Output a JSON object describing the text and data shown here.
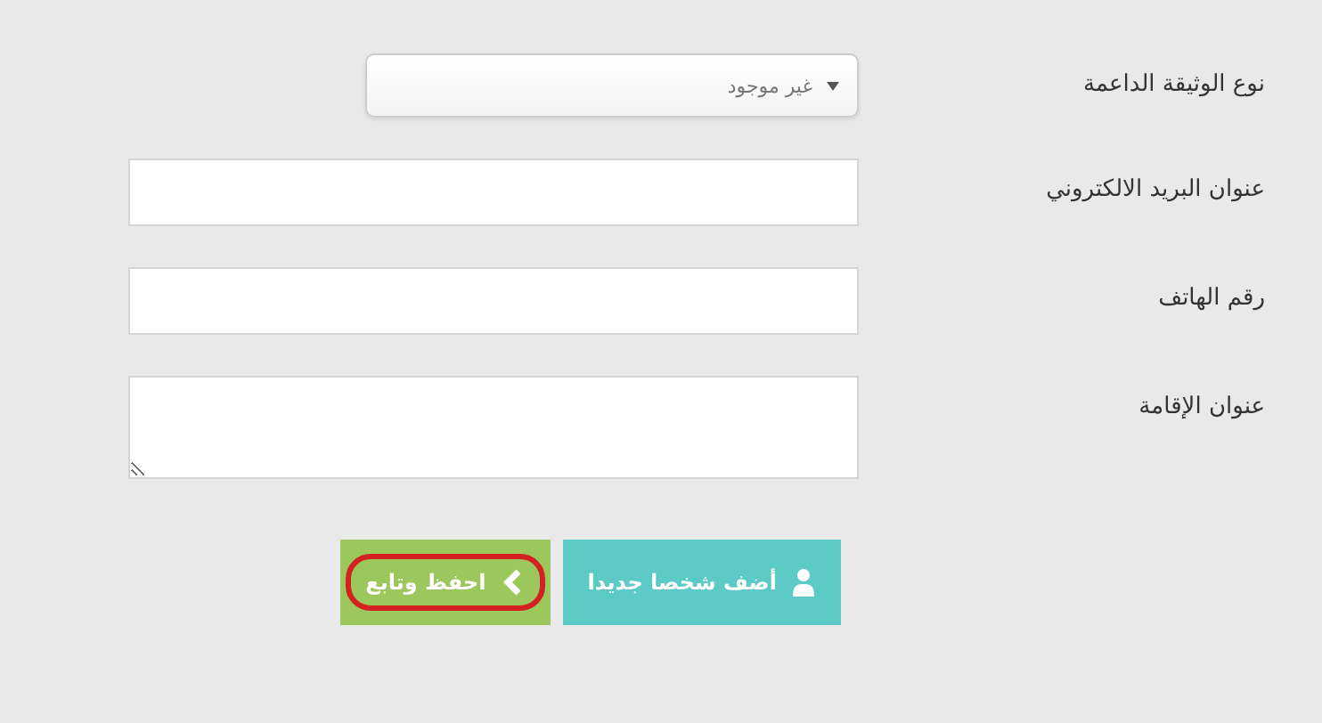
{
  "form": {
    "fields": [
      {
        "label": "نوع الوثيقة الداعمة",
        "kind": "select",
        "value": "غير موجود"
      },
      {
        "label": "عنوان البريد الالكتروني",
        "kind": "text"
      },
      {
        "label": "رقم الهاتف",
        "kind": "text"
      },
      {
        "label": "عنوان الإقامة",
        "kind": "textarea"
      }
    ]
  },
  "buttons": [
    {
      "label": "أضف شخصا جديدا",
      "kind": "add-person",
      "highlighted": false
    },
    {
      "label": "احفظ وتابع",
      "kind": "save-continue",
      "highlighted": true
    }
  ]
}
